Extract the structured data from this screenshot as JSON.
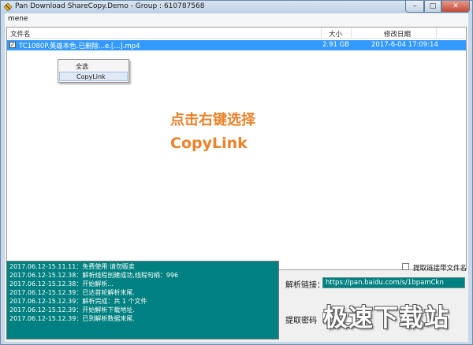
{
  "window": {
    "title": "Pan Download ShareCopy.Demo - Group : 610787568",
    "minimize": "–",
    "maximize": "□",
    "close": "✕"
  },
  "menubar": {
    "item": "mene"
  },
  "listview": {
    "columns": [
      "文件名",
      "大小",
      "修改日期"
    ],
    "rows": [
      {
        "checked": true,
        "name": "TC1080P.英雄本色.已删除...e.[...].mp4",
        "size": "2.91 GB",
        "modified": "2017-6-04 17:09:14"
      }
    ]
  },
  "context_menu": {
    "items": [
      "全选",
      "CopyLink"
    ]
  },
  "annotation": {
    "line1": "点击右键选择",
    "line2": "CopyLink"
  },
  "log": {
    "lines": [
      "2017.06.12-15.11.11：免费使用 请勿贩卖",
      "2017.06.12-15.12.38：解析线程创建成功,线程句柄：996",
      "2017.06.12-15.12.38：开始解析...",
      "2017.06.12-15.12.39：已达首轮解析末尾.",
      "2017.06.12-15.12.39：解析完成：共 1 个文件",
      "2017.06.12-15.12.39：开始解析下载地址.",
      "2017.06.12-15.12.39：已到解析数据末尾."
    ]
  },
  "options": {
    "with_filename_label": "提取链接带文件名",
    "with_filename_checked": false
  },
  "share": {
    "link_label": "解析链接：",
    "link_value": "https://pan.baidu.com/s/1bpamCkn",
    "password_label": "提取密码",
    "password_value": ""
  },
  "watermark": "极速下载站"
}
